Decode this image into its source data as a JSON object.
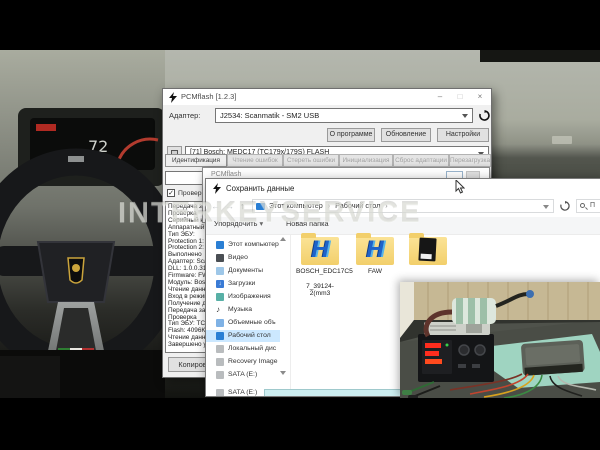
{
  "watermark": "INTERKEYSERVICE",
  "icons": {
    "minimize": "–",
    "maximize": "□",
    "close": "×",
    "back": "←",
    "forward": "→",
    "up": "↑",
    "check": "✓",
    "organize_caret": "▾",
    "scroll_up": "▲",
    "scroll_down": "▼",
    "breadcrumb_sep": "›",
    "music_note": "♪",
    "download_arrow": "↓"
  },
  "colors": {
    "selection_blue": "#cce8ff",
    "folder_yellow": "#f2cf6b",
    "winols_blue": "#1f63c9",
    "led_red": "#ff2d1e",
    "mat_teal": "#9fd4c1"
  },
  "main_window": {
    "title": "PCMflash [1.2.3]",
    "adapter_label": "Адаптер:",
    "adapter_value": "J2534: Scanmatik - SM2 USB",
    "about_button": "О программе",
    "update_button": "Обновление",
    "settings_button": "Настройки",
    "module_value": "[71] Bosch: MEDC17 (TC179x/179S) FLASH",
    "tabs": [
      "Идентификация",
      "Чтение ошибок",
      "Стереть ошибки",
      "Инициализация",
      "Сброс адаптации",
      "Перезагрузка"
    ],
    "checkbox_label": "Проверка/ко",
    "log_lines": [
      "Передача загр",
      "Проверка",
      "Серийный ном",
      "Аппаратный н",
      "Тип ЭБУ:",
      "Protection 1:",
      "Protection 2:",
      "Выполнено",
      "",
      "Адаптер: Scan",
      "DLL: 1.0.0.31 (",
      "Firmware: FW",
      "Модуль: Bosch",
      "Чтение данны",
      "Вход в режим",
      "Получение дост",
      "Передача загр",
      "Проверка",
      "Тип ЭБУ: TC17",
      "Flash: 4096KB",
      "Чтение данны",
      "Завершено усп"
    ],
    "copy_button": "Копировать"
  },
  "mini_dialog": {
    "title": "PCMflash"
  },
  "save_dialog": {
    "title": "Сохранить данные",
    "breadcrumb": {
      "root": "Этот компьютер",
      "current": "Рабочий стол",
      "separator": "›"
    },
    "organize_button": "Упорядочить",
    "new_folder_button": "Новая папка",
    "search_text": "П",
    "sidebar_items": [
      {
        "label": "Этот компьютер"
      },
      {
        "label": "Видео"
      },
      {
        "label": "Документы"
      },
      {
        "label": "Загрузки"
      },
      {
        "label": "Изображения"
      },
      {
        "label": "Музыка"
      },
      {
        "label": "Объемные объ"
      },
      {
        "label": "Рабочий стол"
      },
      {
        "label": "Локальный дис"
      },
      {
        "label": "Recovery Image"
      },
      {
        "label": "SATA (E:)"
      },
      {
        "label": "SATA (E:)"
      }
    ],
    "files": [
      {
        "line1": "BOSCH_EDC17C5",
        "line2": "7_39124-2(mm3"
      },
      {
        "line1": "FAW",
        "line2": ""
      },
      {
        "line1": "",
        "line2": ""
      }
    ]
  }
}
